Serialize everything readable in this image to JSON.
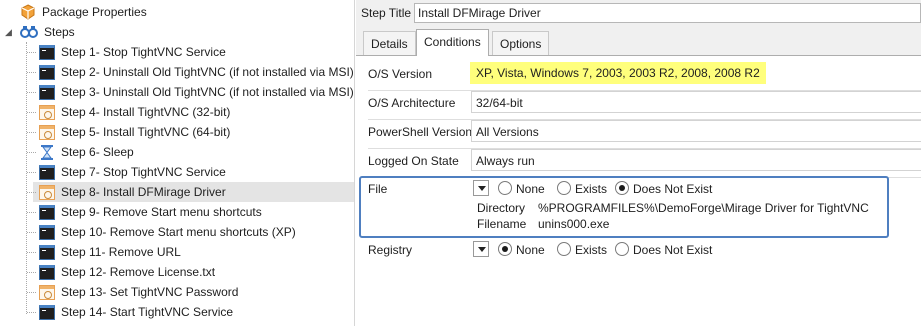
{
  "tree": {
    "package_properties": "Package Properties",
    "steps": "Steps",
    "items": [
      {
        "label": "Step 1- Stop TightVNC Service",
        "icon": "console-icon"
      },
      {
        "label": "Step 2- Uninstall Old TightVNC (if not installed via MSI)",
        "icon": "console-icon"
      },
      {
        "label": "Step 3- Uninstall Old TightVNC (if not installed via MSI)",
        "icon": "console-icon"
      },
      {
        "label": "Step 4- Install TightVNC (32-bit)",
        "icon": "install-icon"
      },
      {
        "label": "Step 5- Install TightVNC (64-bit)",
        "icon": "install-icon"
      },
      {
        "label": "Step 6- Sleep",
        "icon": "hourglass-icon"
      },
      {
        "label": "Step 7- Stop TightVNC Service",
        "icon": "console-icon"
      },
      {
        "label": "Step 8- Install DFMirage Driver",
        "icon": "install-icon",
        "selected": true
      },
      {
        "label": "Step 9- Remove Start menu shortcuts",
        "icon": "console-icon"
      },
      {
        "label": "Step 10- Remove Start menu shortcuts (XP)",
        "icon": "console-icon"
      },
      {
        "label": "Step 11- Remove URL",
        "icon": "console-icon"
      },
      {
        "label": "Step 12- Remove License.txt",
        "icon": "console-icon"
      },
      {
        "label": "Step 13- Set TightVNC Password",
        "icon": "install-icon"
      },
      {
        "label": "Step 14- Start TightVNC Service",
        "icon": "console-icon"
      }
    ]
  },
  "step": {
    "title_label": "Step Title",
    "title_value": "Install DFMirage Driver"
  },
  "tabs": [
    {
      "label": "Details",
      "active": false
    },
    {
      "label": "Conditions",
      "active": true
    },
    {
      "label": "Options",
      "active": false
    }
  ],
  "conditions": {
    "os_version": {
      "label": "O/S Version",
      "value": "XP, Vista, Windows 7, 2003, 2003 R2, 2008, 2008 R2"
    },
    "os_architecture": {
      "label": "O/S Architecture",
      "value": "32/64-bit"
    },
    "powershell": {
      "label": "PowerShell Version",
      "value": "All Versions"
    },
    "logged_on": {
      "label": "Logged On State",
      "value": "Always run"
    },
    "file": {
      "label": "File",
      "options": [
        "None",
        "Exists",
        "Does Not Exist"
      ],
      "selected": "Does Not Exist",
      "directory_label": "Directory",
      "directory_value": "%PROGRAMFILES%\\DemoForge\\Mirage Driver for TightVNC",
      "filename_label": "Filename",
      "filename_value": "unins000.exe"
    },
    "registry": {
      "label": "Registry",
      "options": [
        "None",
        "Exists",
        "Does Not Exist"
      ],
      "selected": "None"
    }
  },
  "colors": {
    "highlight": "#ffff7c",
    "frame": "#4f7fc0",
    "selection": "#e4e4e4"
  }
}
